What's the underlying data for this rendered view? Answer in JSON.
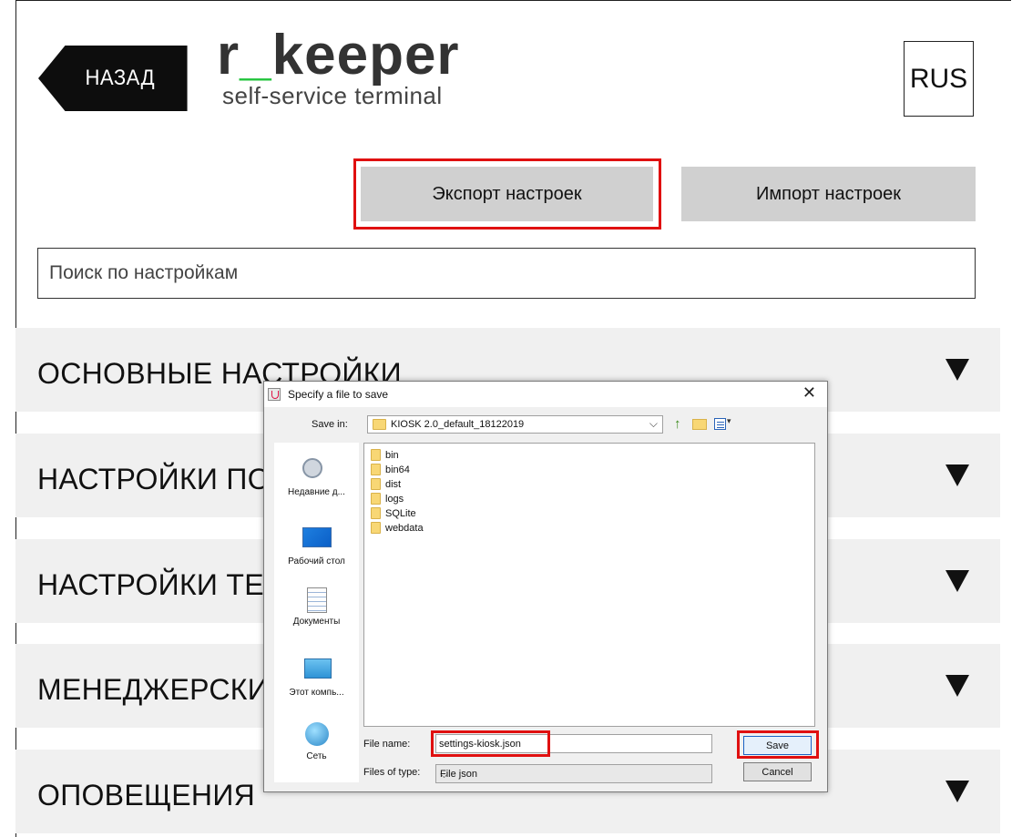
{
  "header": {
    "back_label": "НАЗАД",
    "logo_word_prefix": "r",
    "logo_word_sep": "_",
    "logo_word_suffix": "keeper",
    "logo_subtitle": "self-service terminal",
    "lang_label": "RUS"
  },
  "actions": {
    "export_label": "Экспорт настроек",
    "import_label": "Импорт настроек"
  },
  "search": {
    "placeholder": "Поиск по настройкам"
  },
  "sections": [
    {
      "title": "ОСНОВНЫЕ НАСТРОЙКИ"
    },
    {
      "title": "НАСТРОЙКИ ПОД"
    },
    {
      "title": "НАСТРОЙКИ ТЕМ"
    },
    {
      "title": "МЕНЕДЖЕРСКИЕ"
    },
    {
      "title": "ОПОВЕЩЕНИЯ"
    }
  ],
  "dialog": {
    "title": "Specify a file to save",
    "close_glyph": "✕",
    "save_in_label": "Save in:",
    "save_in_value": "KIOSK 2.0_default_18122019",
    "places": [
      "Недавние д...",
      "Рабочий стол",
      "Документы",
      "Этот компь...",
      "Сеть"
    ],
    "files": [
      "bin",
      "bin64",
      "dist",
      "logs",
      "SQLite",
      "webdata"
    ],
    "file_name_label": "File name:",
    "file_name_value": "settings-kiosk.json",
    "file_type_label": "Files of type:",
    "file_type_value": "File json",
    "save_label": "Save",
    "cancel_label": "Cancel"
  },
  "colors": {
    "accent_green": "#21c43b",
    "highlight_red": "#e01010",
    "button_gray": "#d0d0d0",
    "section_bg": "#f0f0f0"
  }
}
